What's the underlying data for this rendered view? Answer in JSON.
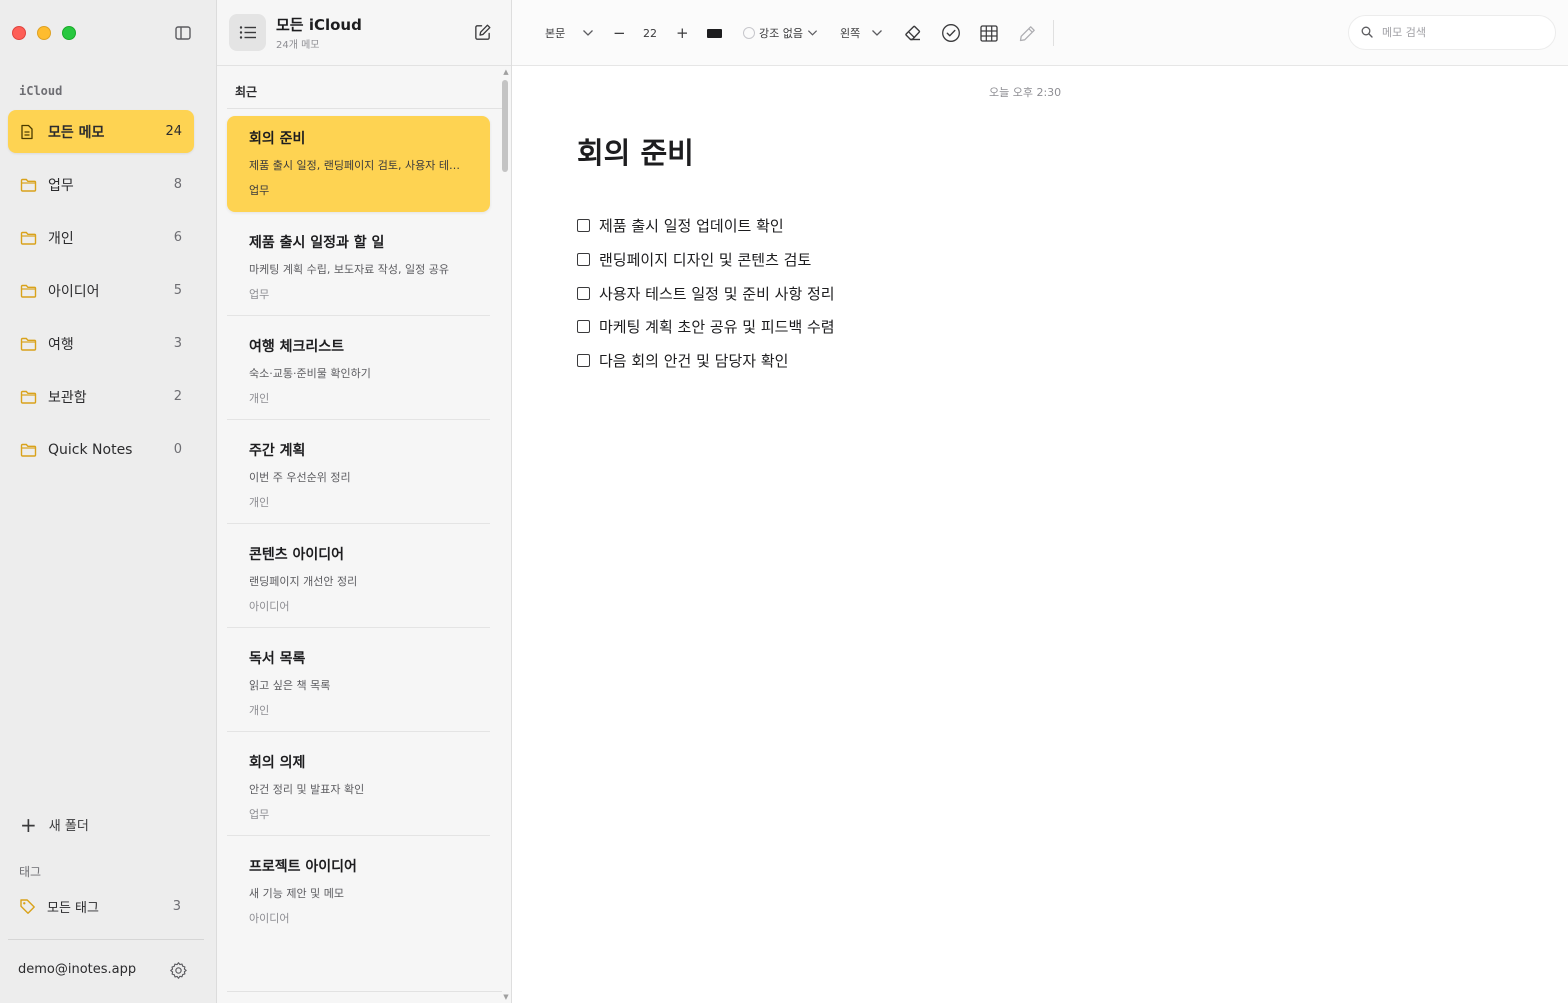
{
  "sidebar": {
    "section_label": "iCloud",
    "folders": [
      {
        "name": "모든 메모",
        "count": "24",
        "icon": "note-icon"
      },
      {
        "name": "업무",
        "count": "8",
        "icon": "folder-icon"
      },
      {
        "name": "개인",
        "count": "6",
        "icon": "folder-icon"
      },
      {
        "name": "아이디어",
        "count": "5",
        "icon": "folder-icon"
      },
      {
        "name": "여행",
        "count": "3",
        "icon": "folder-icon"
      },
      {
        "name": "보관함",
        "count": "2",
        "icon": "folder-icon"
      },
      {
        "name": "Quick Notes",
        "count": "0",
        "icon": "folder-icon"
      }
    ],
    "new_folder_label": "새 폴더",
    "tags_label": "태그",
    "all_tags": {
      "name": "모든 태그",
      "count": "3"
    },
    "account_email": "demo@inotes.app"
  },
  "note_list": {
    "title": "모든 iCloud",
    "subtitle": "24개 메모",
    "section_label": "최근",
    "notes": [
      {
        "title": "회의 준비",
        "preview": "제품 출시 일정, 랜딩페이지 검토, 사용자 테스트 일정 및 준비 사항 정리",
        "folder": "업무"
      },
      {
        "title": "제품 출시 일정과 할 일",
        "preview": "마케팅 계획 수립, 보도자료 작성, 일정 공유",
        "folder": "업무"
      },
      {
        "title": "여행 체크리스트",
        "preview": "숙소·교통·준비물 확인하기",
        "folder": "개인"
      },
      {
        "title": "주간 계획",
        "preview": "이번 주 우선순위 정리",
        "folder": "개인"
      },
      {
        "title": "콘텐츠 아이디어",
        "preview": "랜딩페이지 개선안 정리",
        "folder": "아이디어"
      },
      {
        "title": "독서 목록",
        "preview": "읽고 싶은 책 목록",
        "folder": "개인"
      },
      {
        "title": "회의 의제",
        "preview": "안건 정리 및 발표자 확인",
        "folder": "업무"
      },
      {
        "title": "프로젝트 아이디어",
        "preview": "새 기능 제안 및 메모",
        "folder": "아이디어"
      }
    ]
  },
  "toolbar": {
    "style_label": "본문",
    "minus": "−",
    "font_size": "22",
    "plus": "+",
    "highlight_label": "강조 없음",
    "align_label": "왼쪽",
    "search_placeholder": "메모 검색"
  },
  "editor": {
    "timestamp": "오늘 오후 2:30",
    "title": "회의 준비",
    "checklist": [
      "제품 출시 일정 업데이트 확인",
      "랜딩페이지 디자인 및 콘텐츠 검토",
      "사용자 테스트 일정 및 준비 사항 정리",
      "마케팅 계획 초안 공유 및 피드백 수렴",
      "다음 회의 안건 및 담당자 확인"
    ]
  },
  "colors": {
    "accent": "#fed352",
    "sidebar_bg": "#ededed",
    "list_bg": "#f6f6f6",
    "folder_icon": "#d9a21b"
  }
}
